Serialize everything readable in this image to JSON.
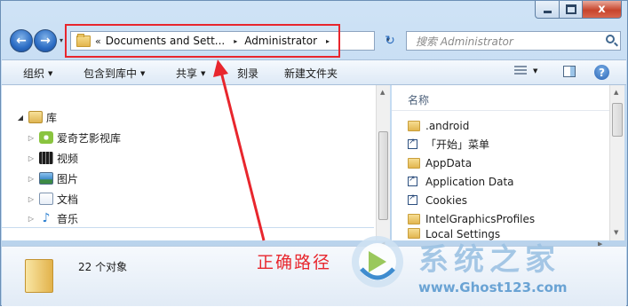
{
  "window": {
    "caption": {
      "minimize": "",
      "maximize": "",
      "close": "x"
    }
  },
  "nav": {
    "back_glyph": "←",
    "forward_glyph": "→",
    "dropdown_glyph": "▾"
  },
  "address": {
    "overflow": "«",
    "crumbs": [
      "Documents and Sett...",
      "Administrator"
    ],
    "separator": "▸",
    "dropdown": "▾",
    "refresh_glyph": "↻"
  },
  "search": {
    "placeholder": "搜索 Administrator"
  },
  "toolbar": {
    "organize": "组织",
    "include_in_library": "包含到库中",
    "share": "共享",
    "burn": "刻录",
    "new_folder": "新建文件夹",
    "dropdown": "▼",
    "help": "?"
  },
  "tree": {
    "expand_open": "◢",
    "expand_closed": "▷",
    "items": [
      {
        "label": "库",
        "icon": "library-icon"
      },
      {
        "label": "爱奇艺影视库",
        "icon": "iqiyi-icon"
      },
      {
        "label": "视频",
        "icon": "video-icon"
      },
      {
        "label": "图片",
        "icon": "pictures-icon"
      },
      {
        "label": "文档",
        "icon": "documents-icon"
      },
      {
        "label": "音乐",
        "icon": "music-icon"
      }
    ]
  },
  "content": {
    "column_name": "名称",
    "items": [
      {
        "label": ".android",
        "type": "folder"
      },
      {
        "label": "「开始」菜单",
        "type": "shortcut"
      },
      {
        "label": "AppData",
        "type": "folder"
      },
      {
        "label": "Application Data",
        "type": "shortcut"
      },
      {
        "label": "Cookies",
        "type": "shortcut"
      },
      {
        "label": "IntelGraphicsProfiles",
        "type": "folder"
      },
      {
        "label": "Local Settings",
        "type": "shortcut"
      }
    ]
  },
  "scroll": {
    "up": "▲",
    "down": "▼",
    "left": "◀",
    "right": "▶"
  },
  "details": {
    "item_count": "22 个对象"
  },
  "annotation": {
    "label": "正确路径",
    "color": "#e8262d"
  },
  "watermark": {
    "title": "系统之家",
    "url": "www.Ghost123.com"
  }
}
